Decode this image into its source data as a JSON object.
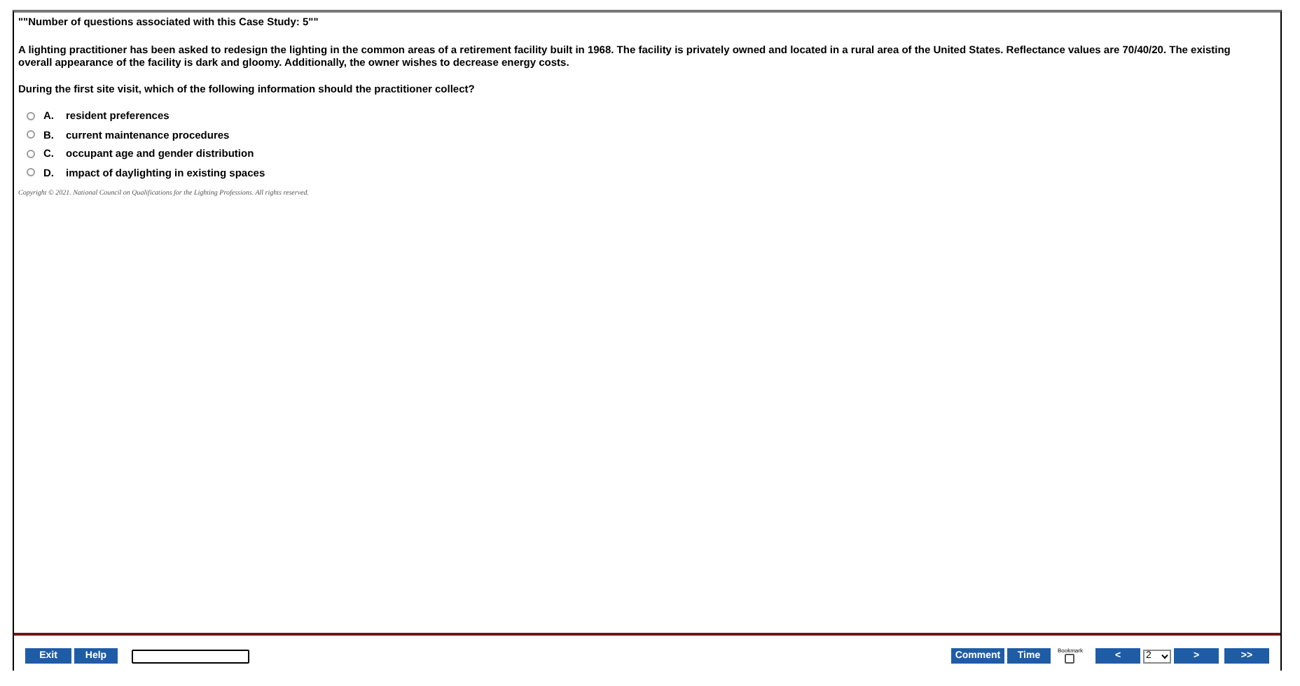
{
  "header": "\"\"Number of questions associated with this Case Study: 5\"\"",
  "scenario": "A lighting practitioner has been asked to redesign the lighting in the common areas of a retirement facility built in 1968.  The facility is privately owned and located in a rural area of the United States.  Reflectance values are 70/40/20.  The existing overall appearance of the facility is dark and gloomy.  Additionally, the owner wishes to decrease energy costs.",
  "question": "During the first site visit, which of the following information should the practitioner collect?",
  "options": [
    {
      "letter": "A.",
      "text": "resident preferences",
      "selected": false
    },
    {
      "letter": "B.",
      "text": "current maintenance procedures",
      "selected": false
    },
    {
      "letter": "C.",
      "text": "occupant age and gender distribution",
      "selected": false
    },
    {
      "letter": "D.",
      "text": "impact of daylighting in existing spaces",
      "selected": false
    }
  ],
  "copyright": "Copyright © 2021. National Council on Qualifications for the Lighting Professions. All rights reserved.",
  "toolbar": {
    "exit": "Exit",
    "help": "Help",
    "comment": "Comment",
    "time": "Time",
    "bookmark": {
      "label": "Bookmark",
      "checked": false
    },
    "prev": "<",
    "page": "2",
    "next": ">",
    "last": ">>"
  }
}
